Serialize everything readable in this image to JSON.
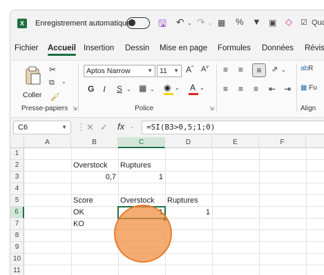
{
  "titlebar": {
    "app_icon": "excel-icon",
    "autosave_label": "Enregistrement automatique",
    "autosave_on": false,
    "quick_access_truncated": "Qua"
  },
  "tabs": [
    "Fichier",
    "Accueil",
    "Insertion",
    "Dessin",
    "Mise en page",
    "Formules",
    "Données",
    "Révisi"
  ],
  "active_tab": "Accueil",
  "ribbon": {
    "clipboard": {
      "paste_label": "Coller",
      "group_label": "Presse-papiers"
    },
    "font": {
      "font_name": "Aptos Narrow",
      "font_size": "11",
      "bold": "G",
      "italic": "I",
      "underline": "S",
      "group_label": "Police",
      "font_color": "#e02020",
      "highlight_color": "#ffd400"
    },
    "alignment": {
      "group_label": "Align",
      "wrap_label": "R",
      "merge_label": "Fu"
    }
  },
  "formula_bar": {
    "name_box": "C6",
    "fx": "fx",
    "formula": "=SI(B3>0,5;1;0)"
  },
  "sheet": {
    "columns": [
      "A",
      "B",
      "C",
      "D",
      "E",
      "F"
    ],
    "rows": [
      "1",
      "2",
      "3",
      "4",
      "5",
      "6",
      "7",
      "8",
      "9",
      "10",
      "11"
    ],
    "selected_cell": "C6",
    "cells": {
      "B2": "Overstock",
      "C2": "Ruptures",
      "B3": "0,7",
      "C3": "1",
      "B5": "Score",
      "C5": "Overstock",
      "D5": "Ruptures",
      "B6": "OK",
      "C6": "1",
      "D6": "1",
      "B7": "KO"
    },
    "accent_color": "#1d6f42"
  },
  "click_indicator": {
    "target_cell": "C6",
    "color": "#f08c3c"
  }
}
